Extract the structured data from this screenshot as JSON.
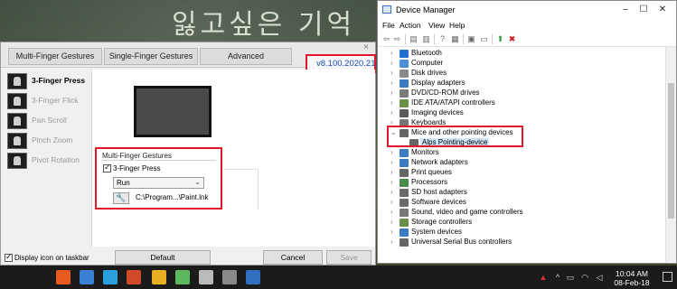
{
  "wallpaper": {
    "text": "잃고싶은 기억"
  },
  "touchpad": {
    "tabs": [
      "Multi-Finger Gestures",
      "Single-Finger Gestures",
      "Advanced"
    ],
    "version": "v8.100.2020.212",
    "side_items": [
      {
        "label": "3-Finger Press",
        "active": true
      },
      {
        "label": "3-Finger Flick",
        "active": false
      },
      {
        "label": "Pan Scroll",
        "active": false
      },
      {
        "label": "Pinch Zoom",
        "active": false
      },
      {
        "label": "Pivot Rotation",
        "active": false
      }
    ],
    "group_title": "Multi-Finger Gestures",
    "checkbox_label": "3-Finger Press",
    "checkbox_checked": true,
    "action_value": "Run",
    "path": "C:\\Program...\\Paint.lnk",
    "display_icon_label": "Display icon on taskbar",
    "display_icon_checked": true,
    "buttons": {
      "default": "Default",
      "cancel": "Cancel",
      "save": "Save"
    }
  },
  "device_manager": {
    "title": "Device Manager",
    "menu": [
      "File",
      "Action",
      "View",
      "Help"
    ],
    "tree": [
      {
        "label": "Bluetooth",
        "color": "#1f6fd1"
      },
      {
        "label": "Computer",
        "color": "#4a90d9"
      },
      {
        "label": "Disk drives",
        "color": "#8a8a8a"
      },
      {
        "label": "Display adapters",
        "color": "#3b7bc2"
      },
      {
        "label": "DVD/CD-ROM drives",
        "color": "#7a7a7a"
      },
      {
        "label": "IDE ATA/ATAPI controllers",
        "color": "#6a8f4a"
      },
      {
        "label": "Imaging devices",
        "color": "#5a5a5a"
      },
      {
        "label": "Keyboards",
        "color": "#777777"
      },
      {
        "label": "Mice and other pointing devices",
        "color": "#666666",
        "expanded": true
      },
      {
        "label": "Alps Pointing-device",
        "color": "#666666",
        "child": true
      },
      {
        "label": "Monitors",
        "color": "#3b7bc2"
      },
      {
        "label": "Network adapters",
        "color": "#3b7bc2"
      },
      {
        "label": "Print queues",
        "color": "#666666"
      },
      {
        "label": "Processors",
        "color": "#4a8a4a"
      },
      {
        "label": "SD host adapters",
        "color": "#6a6a6a"
      },
      {
        "label": "Software devices",
        "color": "#6a6a6a"
      },
      {
        "label": "Sound, video and game controllers",
        "color": "#777777"
      },
      {
        "label": "Storage controllers",
        "color": "#6a8f4a"
      },
      {
        "label": "System devices",
        "color": "#3b7bc2"
      },
      {
        "label": "Universal Serial Bus controllers",
        "color": "#666666"
      }
    ]
  },
  "taskbar": {
    "time": "10:04 AM",
    "date": "08-Feb-18",
    "apps": [
      "#e85a1f",
      "#3a7fd6",
      "#2aa0e0",
      "#d04a2a",
      "#e8b020",
      "#5cb85c",
      "#bbbbbb",
      "#8a8a8a",
      "#3070c0",
      "#c83a3a",
      "#e0e0e0"
    ]
  },
  "colors": {
    "highlight": "#e0162b",
    "version_text": "#1b4fb3"
  }
}
